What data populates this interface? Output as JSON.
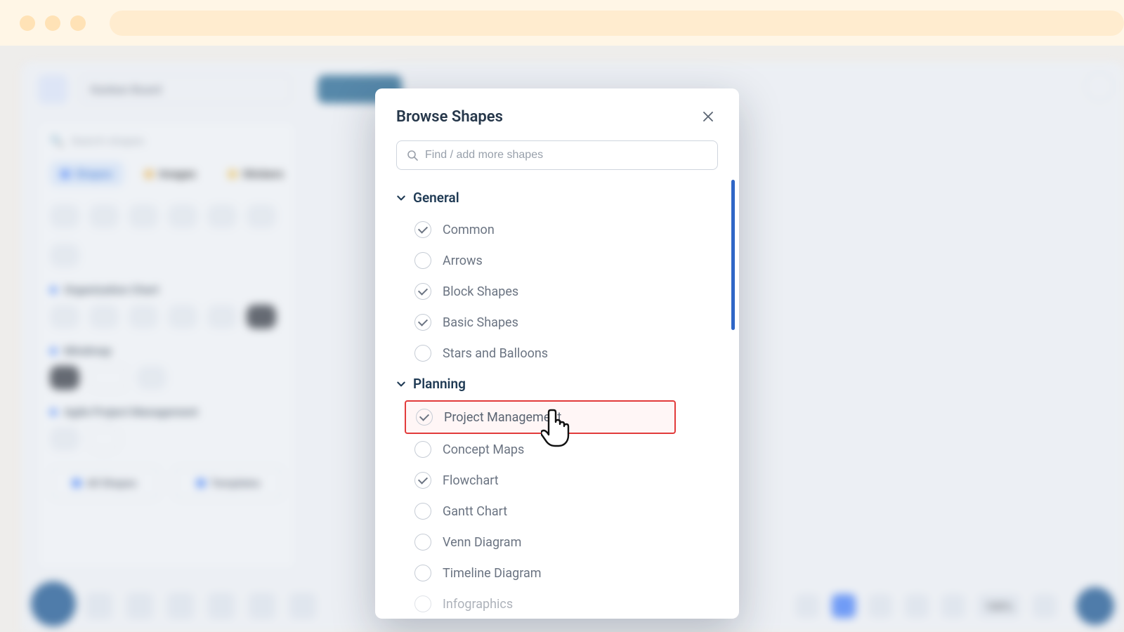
{
  "background": {
    "doc_title": "Kanban Board",
    "sidebar_search_placeholder": "Search shapes",
    "tabs": {
      "shapes": "Shapes",
      "images": "Images",
      "stickers": "Stickers"
    },
    "sections": {
      "org_chart": "Organization Chart",
      "mindmap": "Mindmap",
      "agile_pm": "Agile Project Management"
    },
    "buttons": {
      "all_shapes": "All Shapes",
      "templates": "Templates"
    },
    "zoom_label": "100%"
  },
  "modal": {
    "title": "Browse Shapes",
    "search_placeholder": "Find / add more shapes",
    "sections": [
      {
        "name": "General",
        "items": [
          {
            "label": "Common",
            "checked": true
          },
          {
            "label": "Arrows",
            "checked": false
          },
          {
            "label": "Block Shapes",
            "checked": true
          },
          {
            "label": "Basic Shapes",
            "checked": true
          },
          {
            "label": "Stars and Balloons",
            "checked": false
          }
        ]
      },
      {
        "name": "Planning",
        "items": [
          {
            "label": "Project Management",
            "checked": true,
            "highlighted": true
          },
          {
            "label": "Concept Maps",
            "checked": false
          },
          {
            "label": "Flowchart",
            "checked": true
          },
          {
            "label": "Gantt Chart",
            "checked": false
          },
          {
            "label": "Venn Diagram",
            "checked": false
          },
          {
            "label": "Timeline Diagram",
            "checked": false
          },
          {
            "label": "Infographics",
            "checked": false
          }
        ]
      }
    ]
  }
}
